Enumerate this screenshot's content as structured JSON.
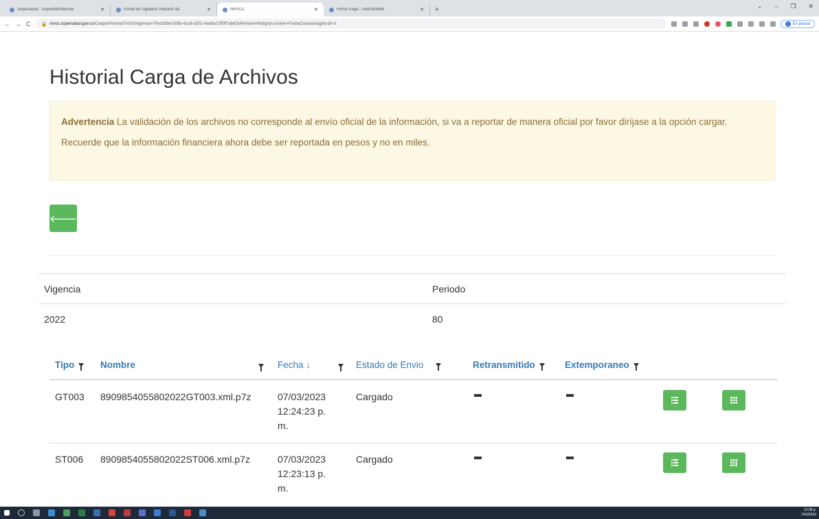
{
  "browser": {
    "tabs": [
      {
        "label": "Supersalud - Superintendencia"
      },
      {
        "label": "Portal de Vigilados Reporte de"
      },
      {
        "label": "NRVCC"
      },
      {
        "label": "Home Page - InterfazWeb"
      }
    ],
    "url_host": "nrvcc.supersalud.gov.co",
    "url_path": "/Cargar/HistorialTxtGnVigencia=70e2d5bd-508b-41a8-a551-4ad8a72f5ff?abdGnPeriodo=80&grid-column=FechaCreacion&grid-dir=1",
    "profile_label": "En pausa"
  },
  "page": {
    "title": "Historial Carga de Archivos",
    "alert": {
      "strong": "Advertencia",
      "text1": " La validación de los archivos no corresponde al envío oficial de la información, si va a reportar de manera oficial por favor diríjase a la opción cargar.",
      "text2": "Recuerde que la información financiera ahora debe ser reportada en pesos y no en miles."
    },
    "info": {
      "vigencia_label": "Vigencia",
      "periodo_label": "Periodo",
      "vigencia_value": "2022",
      "periodo_value": "80"
    },
    "grid": {
      "headers": {
        "tipo": "Tipo",
        "nombre": "Nombre",
        "fecha": "Fecha ↓",
        "estado": "Estado de Envio",
        "retransmitido": "Retransmitido",
        "extemporaneo": "Extemporaneo"
      },
      "rows": [
        {
          "tipo": "GT003",
          "nombre": "8909854055802022GT003.xml.p7z",
          "fecha1": "07/03/2023",
          "fecha2": "12:24:23 p.",
          "fecha3": "m.",
          "estado": "Cargado"
        },
        {
          "tipo": "ST006",
          "nombre": "8909854055802022ST006.xml.p7z",
          "fecha1": "07/03/2023",
          "fecha2": "12:23:13 p.",
          "fecha3": "m.",
          "estado": "Cargado"
        }
      ]
    }
  },
  "taskbar": {
    "time": "12:28 p.",
    "date": "7/03/2023"
  }
}
